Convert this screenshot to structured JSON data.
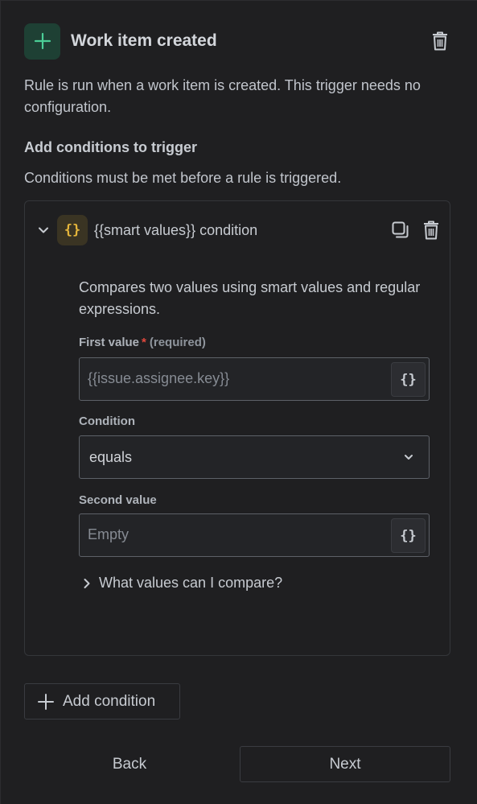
{
  "trigger": {
    "icon": "plus-icon",
    "title": "Work item created",
    "description": "Rule is run when a work item is created. This trigger needs no configuration.",
    "delete_icon": "trash-icon"
  },
  "conditions_section": {
    "heading": "Add conditions to trigger",
    "description": "Conditions must be met before a rule is triggered."
  },
  "condition_card": {
    "icon_glyph": "{}",
    "title": "{{smart values}} condition",
    "expanded": true,
    "actions": [
      "duplicate-icon",
      "trash-icon"
    ],
    "description": "Compares two values using smart values and regular expressions.",
    "first_value": {
      "label": "First value",
      "required_marker": "*",
      "required_text": "(required)",
      "placeholder": "{{issue.assignee.key}}",
      "smart_value_button": "{}"
    },
    "condition": {
      "label": "Condition",
      "selected": "equals"
    },
    "second_value": {
      "label": "Second value",
      "placeholder": "Empty",
      "smart_value_button": "{}"
    },
    "help_expander": "What values can I compare?"
  },
  "add_condition_label": "Add condition",
  "footer": {
    "back_label": "Back",
    "next_label": "Next"
  },
  "colors": {
    "background": "#1f1f21",
    "trigger_icon_bg": "#1e4034",
    "trigger_icon_fg": "#4bce97",
    "smart_icon_bg": "#3a3423",
    "smart_icon_fg": "#e4b53b",
    "required": "#e2483d"
  }
}
